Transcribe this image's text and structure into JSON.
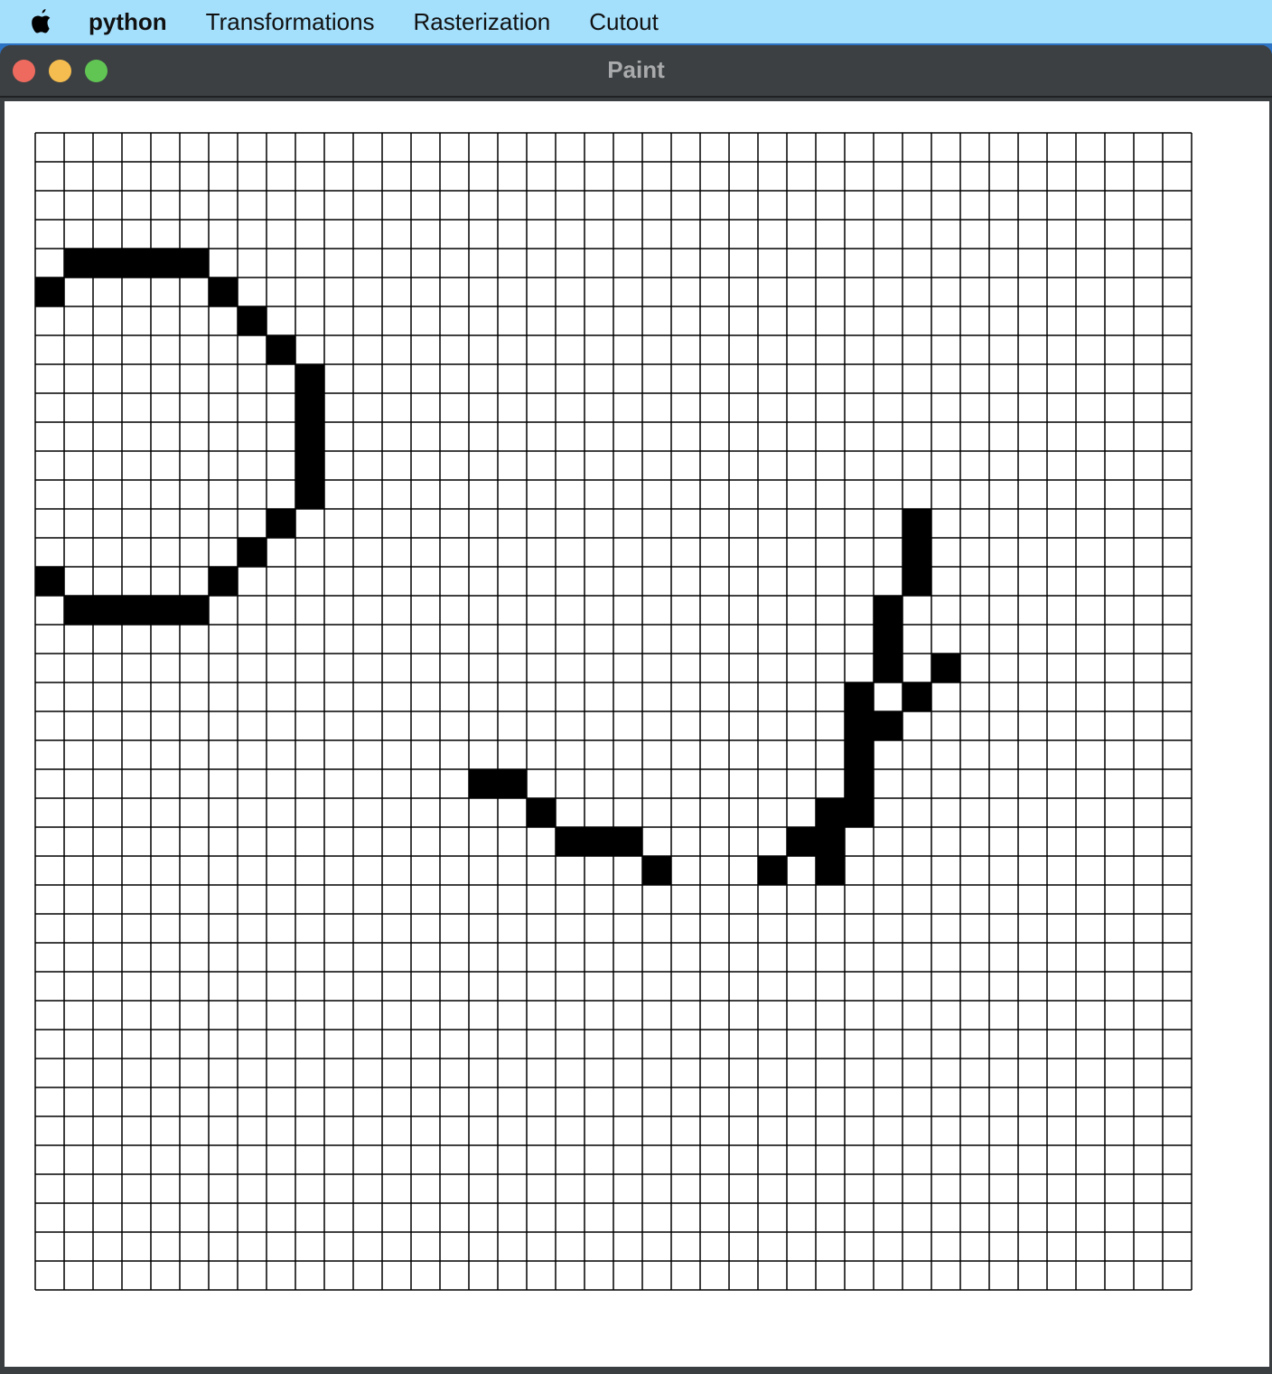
{
  "menubar": {
    "apple_icon": "apple-icon",
    "app_name": "python",
    "items": [
      "Transformations",
      "Rasterization",
      "Cutout"
    ]
  },
  "window": {
    "title": "Paint",
    "traffic_lights": {
      "close": "#ee6a5e",
      "minimize": "#f5bd4f",
      "maximize": "#61c554"
    }
  },
  "canvas": {
    "columns": 40,
    "rows": 40,
    "fill_color": "#000000",
    "grid_color": "#000000",
    "filled_cells": [
      [
        1,
        4
      ],
      [
        2,
        4
      ],
      [
        3,
        4
      ],
      [
        4,
        4
      ],
      [
        5,
        4
      ],
      [
        0,
        5
      ],
      [
        6,
        5
      ],
      [
        7,
        6
      ],
      [
        8,
        7
      ],
      [
        9,
        8
      ],
      [
        9,
        9
      ],
      [
        9,
        10
      ],
      [
        9,
        11
      ],
      [
        9,
        12
      ],
      [
        8,
        13
      ],
      [
        7,
        14
      ],
      [
        0,
        15
      ],
      [
        6,
        15
      ],
      [
        1,
        16
      ],
      [
        2,
        16
      ],
      [
        3,
        16
      ],
      [
        4,
        16
      ],
      [
        5,
        16
      ],
      [
        30,
        13
      ],
      [
        30,
        14
      ],
      [
        30,
        15
      ],
      [
        29,
        16
      ],
      [
        29,
        17
      ],
      [
        29,
        18
      ],
      [
        31,
        18
      ],
      [
        28,
        19
      ],
      [
        30,
        19
      ],
      [
        28,
        20
      ],
      [
        29,
        20
      ],
      [
        28,
        21
      ],
      [
        15,
        22
      ],
      [
        16,
        22
      ],
      [
        28,
        22
      ],
      [
        17,
        23
      ],
      [
        27,
        23
      ],
      [
        28,
        23
      ],
      [
        18,
        24
      ],
      [
        19,
        24
      ],
      [
        20,
        24
      ],
      [
        26,
        24
      ],
      [
        27,
        24
      ],
      [
        21,
        25
      ],
      [
        25,
        25
      ],
      [
        27,
        25
      ]
    ]
  }
}
